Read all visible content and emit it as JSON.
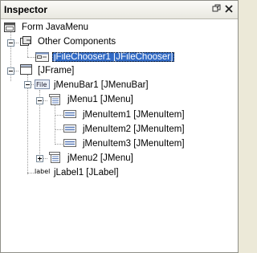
{
  "window": {
    "title": "Inspector"
  },
  "titlebar_icons": [
    "restore-icon",
    "close-icon"
  ],
  "tree": {
    "root": {
      "label": "Form JavaMenu",
      "icon": "form-icon"
    },
    "other_components": {
      "label": "Other Components",
      "icon": "components-icon",
      "expanded": true
    },
    "file_chooser": {
      "label": "jFileChooser1 [JFileChooser]",
      "icon": "file-chooser-icon",
      "selected": true
    },
    "frame": {
      "label": "[JFrame]",
      "icon": "frame-icon",
      "expanded": true
    },
    "menubar": {
      "label": "jMenuBar1 [JMenuBar]",
      "icon": "menubar-icon",
      "icon_text": "File",
      "expanded": true
    },
    "menu1": {
      "label": "jMenu1 [JMenu]",
      "icon": "menu-icon",
      "expanded": true
    },
    "menu_items": [
      {
        "label": "jMenuItem1 [JMenuItem]",
        "icon": "menuitem-icon"
      },
      {
        "label": "jMenuItem2 [JMenuItem]",
        "icon": "menuitem-icon"
      },
      {
        "label": "jMenuItem3 [JMenuItem]",
        "icon": "menuitem-icon"
      }
    ],
    "menu2": {
      "label": "jMenu2 [JMenu]",
      "icon": "menu-icon",
      "expanded": false
    },
    "jlabel": {
      "label": "jLabel1 [JLabel]",
      "icon": "label-icon",
      "icon_text": "label"
    }
  },
  "colors": {
    "selection": "#316ac5",
    "panel_bg": "#ffffff",
    "title_bg": "#ece9d8"
  }
}
